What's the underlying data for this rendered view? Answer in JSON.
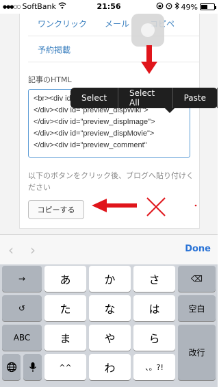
{
  "status_bar": {
    "carrier": "SoftBank",
    "time": "21:56",
    "battery_text": "49%",
    "battery_level": 0.49
  },
  "tabs": {
    "one_click": "ワンクリック",
    "mail": "メール",
    "copy": "コピペ",
    "reservation": "予約掲載"
  },
  "html_section": {
    "label": "記事のHTML",
    "code_lines": [
      "<br><div id=\"preview_dispGoogle\">",
      "</div><div id=\"preview_dispWiki\">",
      "</div><div id=\"preview_dispImage\">",
      "</div><div id=\"preview_dispMovie\">",
      "</div><div id=\"preview_comment\""
    ]
  },
  "instruction": "以下のボタンをクリック後、ブログへ貼り付けください",
  "copy_button": "コピーする",
  "edit_menu": {
    "items": [
      "Select",
      "Select All",
      "Paste"
    ]
  },
  "keyboard_toolbar": {
    "prev_label": "‹",
    "next_label": "›",
    "done": "Done"
  },
  "keyboard": {
    "undo_arrow": "→",
    "undo": "↺",
    "abc": "ABC",
    "globe": "🌐",
    "mic": "🎤",
    "keys": [
      "あ",
      "か",
      "さ",
      "た",
      "な",
      "は",
      "ま",
      "や",
      "ら",
      "^^",
      "わ",
      "、。?!"
    ],
    "delete": "⌫",
    "space": "空白",
    "return": "改行"
  },
  "colors": {
    "link": "#3a7fbf",
    "annotation_red": "#e0151b",
    "done_blue": "#2a73d6"
  }
}
